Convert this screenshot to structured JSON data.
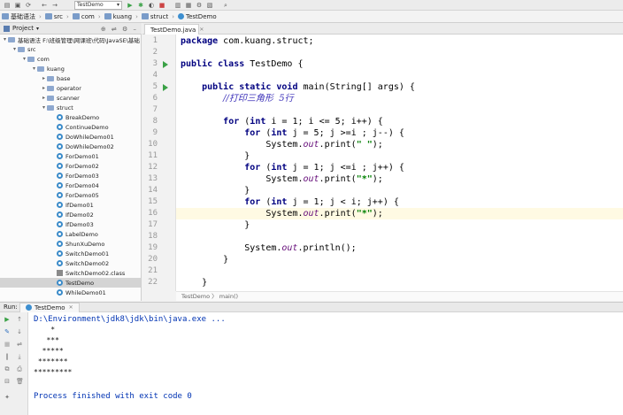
{
  "toolbar": {
    "run_config": "TestDemo",
    "icons": [
      "folder-open-icon",
      "save-icon",
      "sync-icon",
      "back-icon",
      "forward-icon",
      "run-icon",
      "debug-icon",
      "coverage-icon",
      "stop-icon",
      "build-icon",
      "structure-icon",
      "settings-icon",
      "sdk-icon",
      "search-icon"
    ]
  },
  "breadcrumb": [
    "基础语法",
    "src",
    "com",
    "kuang",
    "struct",
    "TestDemo"
  ],
  "project_panel": {
    "title": "Project",
    "rows": [
      {
        "label": "基础语法  F:\\班级管理\\网课班\\代码\\JavaSE\\基础",
        "depth": 0,
        "kind": "module",
        "expanded": true
      },
      {
        "label": "src",
        "depth": 1,
        "kind": "folder",
        "expanded": true
      },
      {
        "label": "com",
        "depth": 2,
        "kind": "folder",
        "expanded": true
      },
      {
        "label": "kuang",
        "depth": 3,
        "kind": "folder",
        "expanded": true
      },
      {
        "label": "base",
        "depth": 4,
        "kind": "folder",
        "expanded": false
      },
      {
        "label": "operator",
        "depth": 4,
        "kind": "folder",
        "expanded": false
      },
      {
        "label": "scanner",
        "depth": 4,
        "kind": "folder",
        "expanded": false
      },
      {
        "label": "struct",
        "depth": 4,
        "kind": "folder",
        "expanded": true
      },
      {
        "label": "BreakDemo",
        "depth": 5,
        "kind": "class"
      },
      {
        "label": "ContinueDemo",
        "depth": 5,
        "kind": "class"
      },
      {
        "label": "DoWhileDemo01",
        "depth": 5,
        "kind": "class"
      },
      {
        "label": "DoWhileDemo02",
        "depth": 5,
        "kind": "class"
      },
      {
        "label": "ForDemo01",
        "depth": 5,
        "kind": "class"
      },
      {
        "label": "ForDemo02",
        "depth": 5,
        "kind": "class"
      },
      {
        "label": "ForDemo03",
        "depth": 5,
        "kind": "class"
      },
      {
        "label": "ForDemo04",
        "depth": 5,
        "kind": "class"
      },
      {
        "label": "ForDemo05",
        "depth": 5,
        "kind": "class"
      },
      {
        "label": "IfDemo01",
        "depth": 5,
        "kind": "class"
      },
      {
        "label": "IfDemo02",
        "depth": 5,
        "kind": "class"
      },
      {
        "label": "IfDemo03",
        "depth": 5,
        "kind": "class"
      },
      {
        "label": "LabelDemo",
        "depth": 5,
        "kind": "class"
      },
      {
        "label": "ShunXuDemo",
        "depth": 5,
        "kind": "class"
      },
      {
        "label": "SwitchDemo01",
        "depth": 5,
        "kind": "class"
      },
      {
        "label": "SwitchDemo02",
        "depth": 5,
        "kind": "class"
      },
      {
        "label": "SwitchDemo02.class",
        "depth": 5,
        "kind": "classfile"
      },
      {
        "label": "TestDemo",
        "depth": 5,
        "kind": "class",
        "selected": true
      },
      {
        "label": "WhileDemo01",
        "depth": 5,
        "kind": "class"
      }
    ]
  },
  "editor": {
    "tab_label": "TestDemo.java",
    "run_gutter_lines": [
      3,
      5
    ],
    "highlighted_line": 16,
    "lines": [
      {
        "n": "1",
        "segs": [
          {
            "t": "package ",
            "c": "kw"
          },
          {
            "t": "com.kuang.struct;",
            "c": ""
          }
        ]
      },
      {
        "n": "2",
        "segs": []
      },
      {
        "n": "3",
        "segs": [
          {
            "t": "public class ",
            "c": "kw"
          },
          {
            "t": "TestDemo {",
            "c": ""
          }
        ]
      },
      {
        "n": "4",
        "segs": []
      },
      {
        "n": "5",
        "segs": [
          {
            "t": "    ",
            "c": ""
          },
          {
            "t": "public static void ",
            "c": "kw"
          },
          {
            "t": "main(String[] args) {",
            "c": ""
          }
        ]
      },
      {
        "n": "6",
        "segs": [
          {
            "t": "        ",
            "c": ""
          },
          {
            "t": "//打印三角形  5行",
            "c": "cm"
          }
        ]
      },
      {
        "n": "7",
        "segs": []
      },
      {
        "n": "8",
        "segs": [
          {
            "t": "        ",
            "c": ""
          },
          {
            "t": "for ",
            "c": "kw"
          },
          {
            "t": "(",
            "c": ""
          },
          {
            "t": "int ",
            "c": "kw"
          },
          {
            "t": "i = 1; i <= 5; i++) {",
            "c": ""
          }
        ]
      },
      {
        "n": "9",
        "segs": [
          {
            "t": "            ",
            "c": ""
          },
          {
            "t": "for ",
            "c": "kw"
          },
          {
            "t": "(",
            "c": ""
          },
          {
            "t": "int ",
            "c": "kw"
          },
          {
            "t": "j = 5; j >=i ; j--) {",
            "c": ""
          }
        ]
      },
      {
        "n": "10",
        "segs": [
          {
            "t": "                System.",
            "c": ""
          },
          {
            "t": "out",
            "c": "it"
          },
          {
            "t": ".print(",
            "c": ""
          },
          {
            "t": "\" \"",
            "c": "st"
          },
          {
            "t": ");",
            "c": ""
          }
        ]
      },
      {
        "n": "11",
        "segs": [
          {
            "t": "            }",
            "c": ""
          }
        ]
      },
      {
        "n": "12",
        "segs": [
          {
            "t": "            ",
            "c": ""
          },
          {
            "t": "for ",
            "c": "kw"
          },
          {
            "t": "(",
            "c": ""
          },
          {
            "t": "int ",
            "c": "kw"
          },
          {
            "t": "j = 1; j <=i ; j++) {",
            "c": ""
          }
        ]
      },
      {
        "n": "13",
        "segs": [
          {
            "t": "                System.",
            "c": ""
          },
          {
            "t": "out",
            "c": "it"
          },
          {
            "t": ".print(",
            "c": ""
          },
          {
            "t": "\"*\"",
            "c": "st"
          },
          {
            "t": ");",
            "c": ""
          }
        ]
      },
      {
        "n": "14",
        "segs": [
          {
            "t": "            }",
            "c": ""
          }
        ]
      },
      {
        "n": "15",
        "segs": [
          {
            "t": "            ",
            "c": ""
          },
          {
            "t": "for ",
            "c": "kw"
          },
          {
            "t": "(",
            "c": ""
          },
          {
            "t": "int ",
            "c": "kw"
          },
          {
            "t": "j = 1; j < i; j++) {",
            "c": ""
          }
        ]
      },
      {
        "n": "16",
        "segs": [
          {
            "t": "                System.",
            "c": ""
          },
          {
            "t": "out",
            "c": "it"
          },
          {
            "t": ".print(",
            "c": ""
          },
          {
            "t": "\"*\"",
            "c": "st"
          },
          {
            "t": ");",
            "c": ""
          }
        ]
      },
      {
        "n": "17",
        "segs": [
          {
            "t": "            }",
            "c": ""
          }
        ]
      },
      {
        "n": "18",
        "segs": []
      },
      {
        "n": "19",
        "segs": [
          {
            "t": "            System.",
            "c": ""
          },
          {
            "t": "out",
            "c": "it"
          },
          {
            "t": ".println();",
            "c": ""
          }
        ]
      },
      {
        "n": "20",
        "segs": [
          {
            "t": "        }",
            "c": ""
          }
        ]
      },
      {
        "n": "21",
        "segs": []
      },
      {
        "n": "22",
        "segs": [
          {
            "t": "    }",
            "c": ""
          }
        ]
      }
    ],
    "breadcrumb": "TestDemo  〉  main()"
  },
  "run_panel": {
    "label": "Run:",
    "tab_label": "TestDemo",
    "command": "D:\\Environment\\jdk8\\jdk\\bin\\java.exe ...",
    "output": [
      "    *",
      "   ***",
      "  *****",
      " *******",
      "*********"
    ],
    "finished": "Process finished with exit code 0"
  },
  "colors": {
    "keyword": "#000080",
    "string": "#008000",
    "comment": "#3a2fb8",
    "field": "#660e7a",
    "console_text": "#0033b3",
    "run_green": "#3aa146",
    "line_highlight": "#fffae3"
  }
}
